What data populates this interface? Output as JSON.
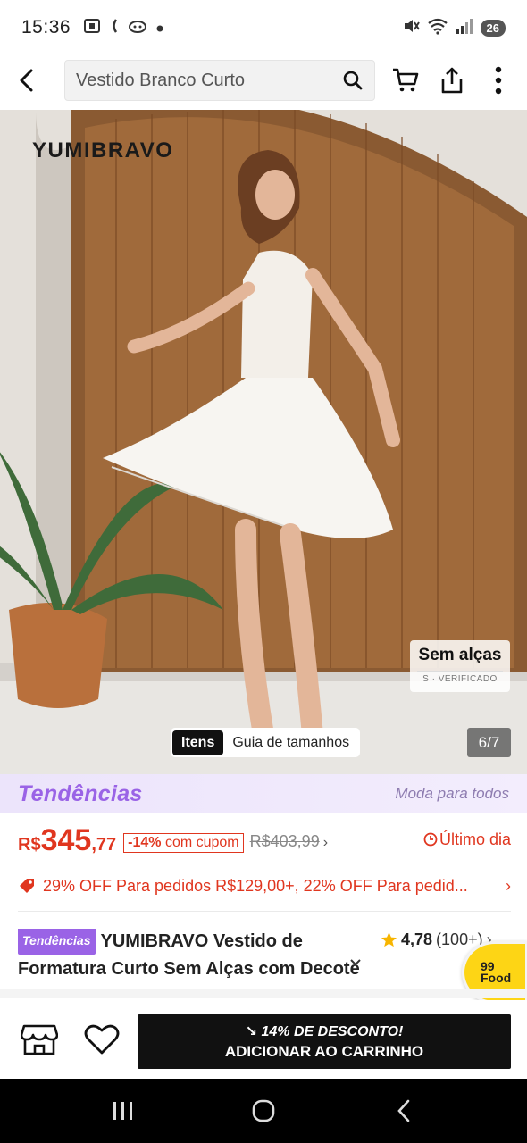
{
  "status_bar": {
    "time": "15:36",
    "battery": "26"
  },
  "search": {
    "query": "Vestido Branco Curto"
  },
  "image": {
    "brand": "YUMIBRAVO",
    "feature_title": "Sem alças",
    "feature_subtitle": "S · VERIFICADO",
    "toggle_items": "Itens",
    "toggle_guide": "Guia de tamanhos",
    "counter": "6/7"
  },
  "banner": {
    "logo": "Tendências",
    "slogan": "Moda para todos"
  },
  "price": {
    "currency": "R$",
    "main": "345",
    "cents": ",77",
    "coupon_percent": "-14%",
    "coupon_text": "com cupom",
    "old_price": "R$403,99",
    "last_day": "Último dia"
  },
  "promo": {
    "text": "29% OFF Para pedidos R$129,00+,  22% OFF Para pedid..."
  },
  "product": {
    "trend_pill": "Tendências",
    "title_line1": "YUMIBRAVO Vestido de",
    "title_line2": "Formatura Curto Sem Alças com Decote",
    "rating": "4,78",
    "rating_count": "(100+)"
  },
  "food_badge": {
    "line1": "99",
    "line2": "Food"
  },
  "action_bar": {
    "discount": "14% DE DESCONTO!",
    "add_to_cart": "ADICIONAR AO CARRINHO"
  },
  "colors": {
    "accent_red": "#e0361f",
    "trend_purple": "#9a63e6",
    "cta_black": "#111111",
    "food_yellow": "#fdd515"
  }
}
